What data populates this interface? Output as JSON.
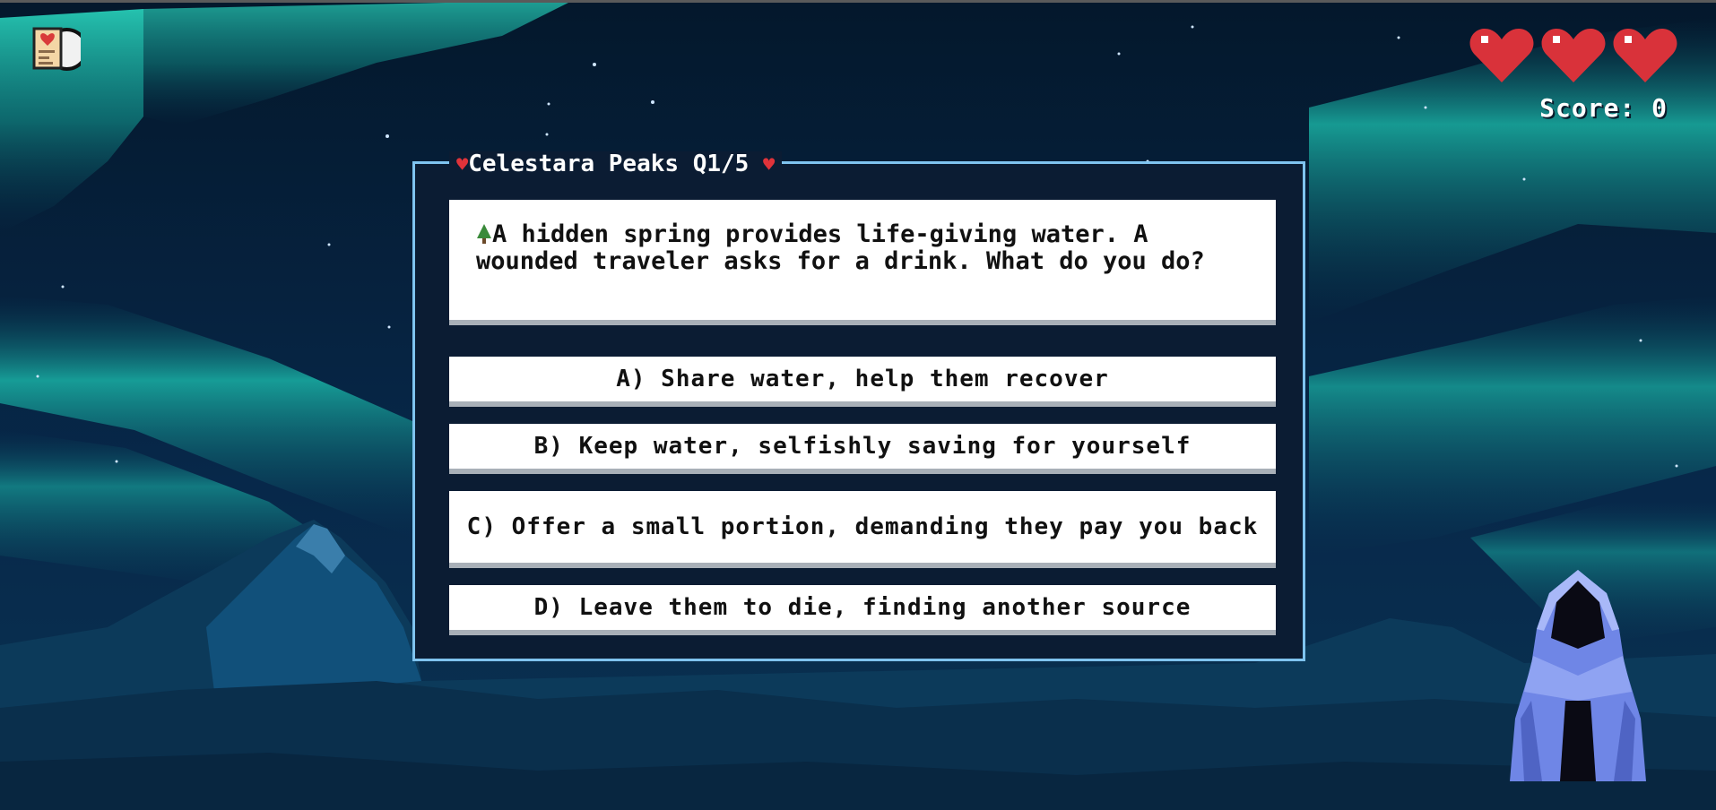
{
  "hud": {
    "journal_icon": "journal-icon",
    "hearts": [
      "heart-icon",
      "heart-icon",
      "heart-icon"
    ],
    "lives": 3,
    "score_text": "Score: 0"
  },
  "quiz": {
    "title_heart_left": "♥",
    "title": "Celestara Peaks Q1/5",
    "title_heart_right": "♥",
    "question_icon": "pine-tree-icon",
    "question": "A hidden spring provides life-giving water. A wounded traveler asks for a drink. What do you do?",
    "answers": [
      {
        "label": "A) Share water, help them recover"
      },
      {
        "label": "B) Keep water, selfishly saving for yourself"
      },
      {
        "label": "C) Offer a small portion, demanding they pay you back"
      },
      {
        "label": "D) Leave them to die, finding another source"
      }
    ]
  },
  "character": "hooded-cloak-figure",
  "colors": {
    "sky": "#062238",
    "aurora": "#1fb8a8",
    "mountains": "#0c3a5a",
    "panel_bg": "#0b1c33",
    "panel_border": "#7fc3ef",
    "heart_red": "#e0333a",
    "cloak_blue": "#6f86e6"
  }
}
